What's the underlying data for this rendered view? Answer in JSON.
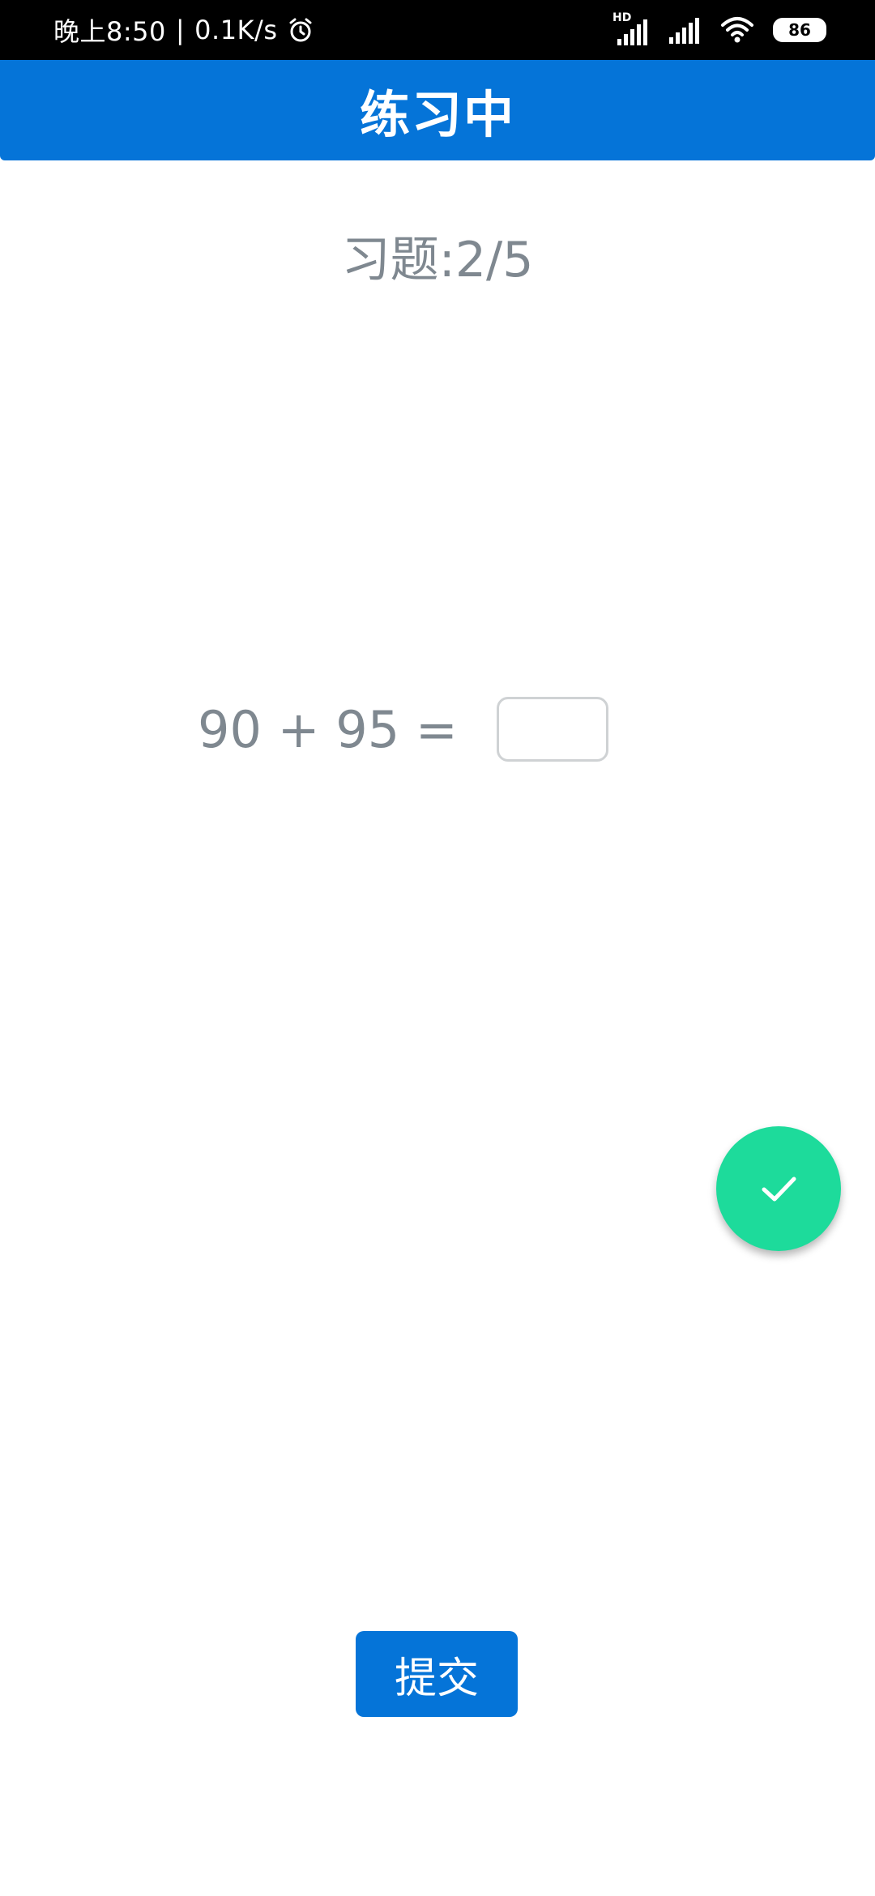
{
  "status_bar": {
    "time": "晚上8:50",
    "separator": "|",
    "network_speed": "0.1K/s",
    "alarm_icon": "alarm-clock-icon",
    "hd_label": "HD",
    "signal_icons": [
      "signal-hd-icon",
      "signal-icon"
    ],
    "wifi_icon": "wifi-icon",
    "battery_level": "86"
  },
  "app_bar": {
    "title": "练习中",
    "color": "#0574d8"
  },
  "quiz": {
    "progress_text": "习题:2/5",
    "equation": "90 + 95 =",
    "answer_value": "",
    "answer_placeholder": ""
  },
  "fab": {
    "icon": "check-icon",
    "color": "#1ddb9b"
  },
  "submit_button": {
    "label": "提交"
  }
}
